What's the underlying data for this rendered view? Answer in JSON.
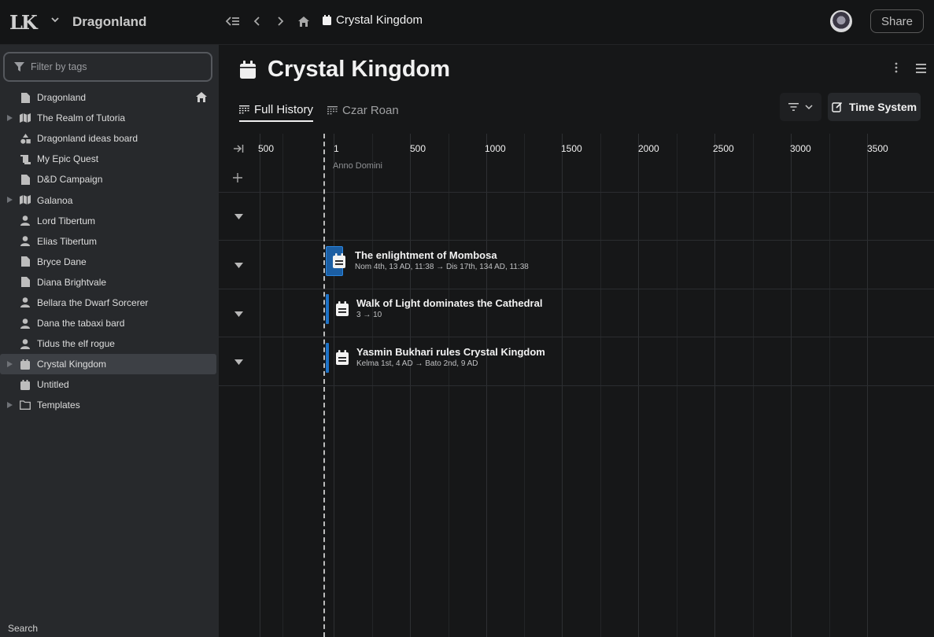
{
  "topbar": {
    "logo": "LK",
    "workspace": "Dragonland",
    "breadcrumb": "Crystal Kingdom",
    "share_label": "Share"
  },
  "sidebar": {
    "filter_placeholder": "Filter by tags",
    "items": [
      {
        "label": "Dragonland",
        "icon": "page-icon",
        "expandable": false,
        "home": true
      },
      {
        "label": "The Realm of Tutoria",
        "icon": "map-icon",
        "expandable": true
      },
      {
        "label": "Dragonland ideas board",
        "icon": "shapes-icon",
        "expandable": false
      },
      {
        "label": "My Epic Quest",
        "icon": "scroll-icon",
        "expandable": false
      },
      {
        "label": "D&D Campaign",
        "icon": "page-icon",
        "expandable": false
      },
      {
        "label": "Galanoa",
        "icon": "map-icon",
        "expandable": true
      },
      {
        "label": "Lord Tibertum",
        "icon": "person-icon",
        "expandable": false
      },
      {
        "label": "Elias Tibertum",
        "icon": "person-icon",
        "expandable": false
      },
      {
        "label": "Bryce Dane",
        "icon": "page-icon",
        "expandable": false
      },
      {
        "label": "Diana Brightvale",
        "icon": "page-icon",
        "expandable": false
      },
      {
        "label": "Bellara the Dwarf Sorcerer",
        "icon": "person-icon",
        "expandable": false
      },
      {
        "label": "Dana the tabaxi bard",
        "icon": "person-icon",
        "expandable": false
      },
      {
        "label": "Tidus the elf rogue",
        "icon": "person-icon",
        "expandable": false
      },
      {
        "label": "Crystal Kingdom",
        "icon": "calendar-icon",
        "expandable": true,
        "active": true
      },
      {
        "label": "Untitled",
        "icon": "calendar-icon",
        "expandable": false
      },
      {
        "label": "Templates",
        "icon": "folder-icon",
        "expandable": true
      }
    ],
    "search_label": "Search"
  },
  "main": {
    "title": "Crystal Kingdom",
    "tabs": [
      {
        "label": "Full History",
        "active": true
      },
      {
        "label": "Czar Roan",
        "active": false
      }
    ],
    "time_system_label": "Time System"
  },
  "timeline": {
    "ticks": [
      "500",
      "1",
      "500",
      "1000",
      "1500",
      "2000",
      "2500",
      "3000",
      "3500"
    ],
    "era_label": "Anno Domini",
    "events": [
      {
        "title": "The enlightment of Mombosa",
        "range": "Nom 4th, 13 AD, 11:38 → Dis 17th, 134 AD, 11:38"
      },
      {
        "title": "Walk of Light dominates the Cathedral",
        "range": "3 → 10"
      },
      {
        "title": "Yasmin Bukhari rules Crystal Kingdom",
        "range": "Kelma 1st, 4 AD → Bato 2nd, 9 AD"
      }
    ],
    "accent_color": "#1e73c8"
  }
}
